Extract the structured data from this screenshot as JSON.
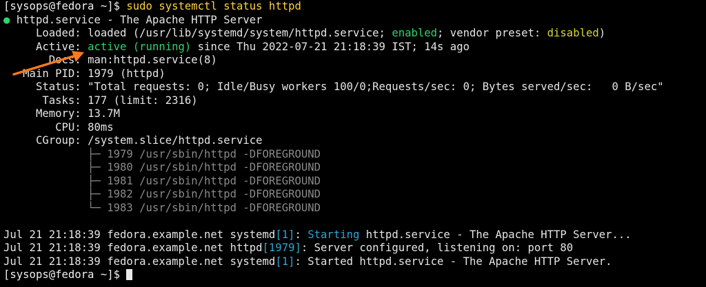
{
  "prompt": "[sysops@fedora ~]$ ",
  "command": "sudo systemctl status httpd",
  "service_line": {
    "dot": "●",
    "text": " httpd.service - The Apache HTTP Server"
  },
  "loaded": {
    "label": "     Loaded: ",
    "pre": "loaded (/usr/lib/systemd/system/httpd.service; ",
    "enabled": "enabled",
    "mid": "; vendor preset: ",
    "disabled": "disabled",
    "post": ")"
  },
  "active": {
    "label": "     Active: ",
    "state": "active (running)",
    "rest": " since Thu 2022-07-21 21:18:39 IST; 14s ago"
  },
  "docs": {
    "label": "       Docs: ",
    "value": "man:httpd.service(8)"
  },
  "main_pid": {
    "label": "   Main PID: ",
    "value": "1979 (httpd)"
  },
  "status": {
    "label": "     Status: ",
    "value": "\"Total requests: 0; Idle/Busy workers 100/0;Requests/sec: 0; Bytes served/sec:   0 B/sec\""
  },
  "tasks": {
    "label": "      Tasks: ",
    "value": "177 (limit: 2316)"
  },
  "memory": {
    "label": "     Memory: ",
    "value": "13.7M"
  },
  "cpu": {
    "label": "        CPU: ",
    "value": "80ms"
  },
  "cgroup": {
    "label": "     CGroup: ",
    "value": "/system.slice/httpd.service"
  },
  "processes": [
    {
      "tree": "             ├─ ",
      "text": "1979 /usr/sbin/httpd -DFOREGROUND"
    },
    {
      "tree": "             ├─ ",
      "text": "1980 /usr/sbin/httpd -DFOREGROUND"
    },
    {
      "tree": "             ├─ ",
      "text": "1981 /usr/sbin/httpd -DFOREGROUND"
    },
    {
      "tree": "             ├─ ",
      "text": "1982 /usr/sbin/httpd -DFOREGROUND"
    },
    {
      "tree": "             └─ ",
      "text": "1983 /usr/sbin/httpd -DFOREGROUND"
    }
  ],
  "log": [
    {
      "prefix": "Jul 21 21:18:39 fedora.example.net systemd",
      "pid": "[1]",
      "colon": ": ",
      "hl": "Starting",
      "rest": " httpd.service - The Apache HTTP Server..."
    },
    {
      "prefix": "Jul 21 21:18:39 fedora.example.net httpd",
      "pid": "[1979]",
      "colon": ": ",
      "hl": "",
      "rest": "Server configured, listening on: port 80"
    },
    {
      "prefix": "Jul 21 21:18:39 fedora.example.net systemd",
      "pid": "[1]",
      "colon": ": ",
      "hl": "",
      "rest": "Started httpd.service - The Apache HTTP Server."
    }
  ],
  "colors": {
    "background": "#000000",
    "command": "#ffd23f",
    "ok_green": "#2fd36b",
    "warn_yellow": "#d6d635",
    "pid_blue": "#2aa7d6",
    "process_gray": "#8a8a8a",
    "annotation_arrow": "#ff7a1a"
  },
  "annotation": {
    "icon": "arrow-icon"
  }
}
